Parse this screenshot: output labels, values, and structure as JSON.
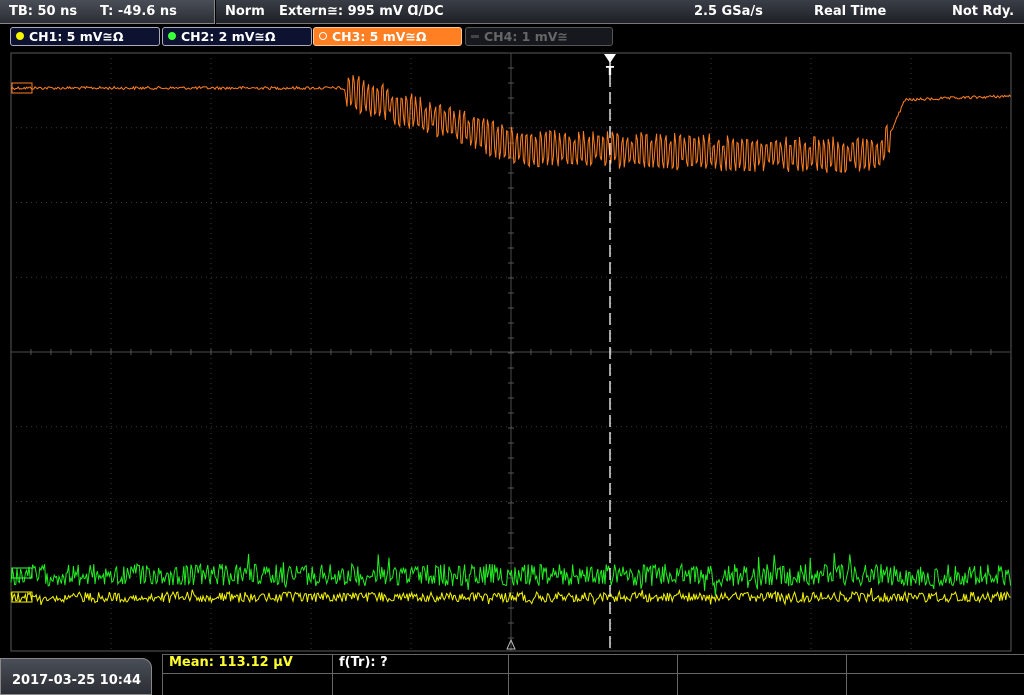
{
  "timebase": {
    "tb": "TB: 50 ns",
    "t": "T: -49.6 ns"
  },
  "status": {
    "mode": "Norm",
    "trigger": "Extern≅: 995 mV Ɑ/DC",
    "sample_rate": "2.5 GSa/s",
    "acq_mode": "Real Time",
    "state": "Not Rdy."
  },
  "channels": [
    {
      "label": "CH1: 5 mV≅Ω",
      "color": "#f4f400"
    },
    {
      "label": "CH2: 2 mV≅Ω",
      "color": "#3cff3c"
    },
    {
      "label": "CH3: 5 mV≅Ω",
      "color": "#ff7f22"
    },
    {
      "label": "CH4: 1 mV≅",
      "color": "#666666"
    }
  ],
  "bottom": {
    "datetime": "2017-03-25 10:44",
    "mean": "Mean: 113.12 µV",
    "ftr": "f(Tr): ?"
  },
  "markers": {
    "trigger": "T"
  },
  "trace_colors": {
    "ch1": "#f4f400",
    "ch2": "#22ee22",
    "ch3": "#ff7f22"
  }
}
